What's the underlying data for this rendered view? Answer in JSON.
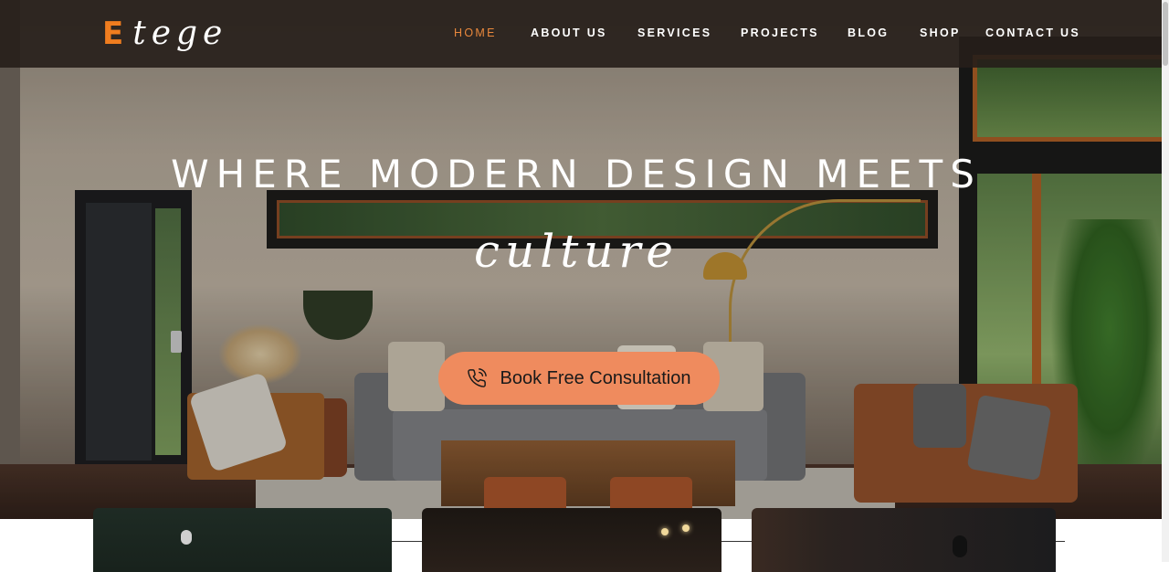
{
  "brand": {
    "logo_first": "E",
    "logo_rest": "tege",
    "accent_color": "#f07d1f"
  },
  "nav": {
    "items": [
      {
        "label": "HOME",
        "active": true
      },
      {
        "label": "ABOUT US",
        "active": false
      },
      {
        "label": "SERVICES",
        "active": false
      },
      {
        "label": "PROJECTS",
        "active": false
      },
      {
        "label": "BLOG",
        "active": false
      },
      {
        "label": "SHOP",
        "active": false
      },
      {
        "label": "CONTACT US",
        "active": false
      }
    ],
    "active_color": "#e9883d"
  },
  "hero": {
    "title": "WHERE MODERN DESIGN MEETS",
    "script": "culture",
    "cta_label": "Book Free Consultation",
    "cta_icon": "phone-icon",
    "cta_color": "#ef8b5e"
  },
  "cards": [
    {
      "name": "project-card-1"
    },
    {
      "name": "project-card-2"
    },
    {
      "name": "project-card-3"
    }
  ]
}
